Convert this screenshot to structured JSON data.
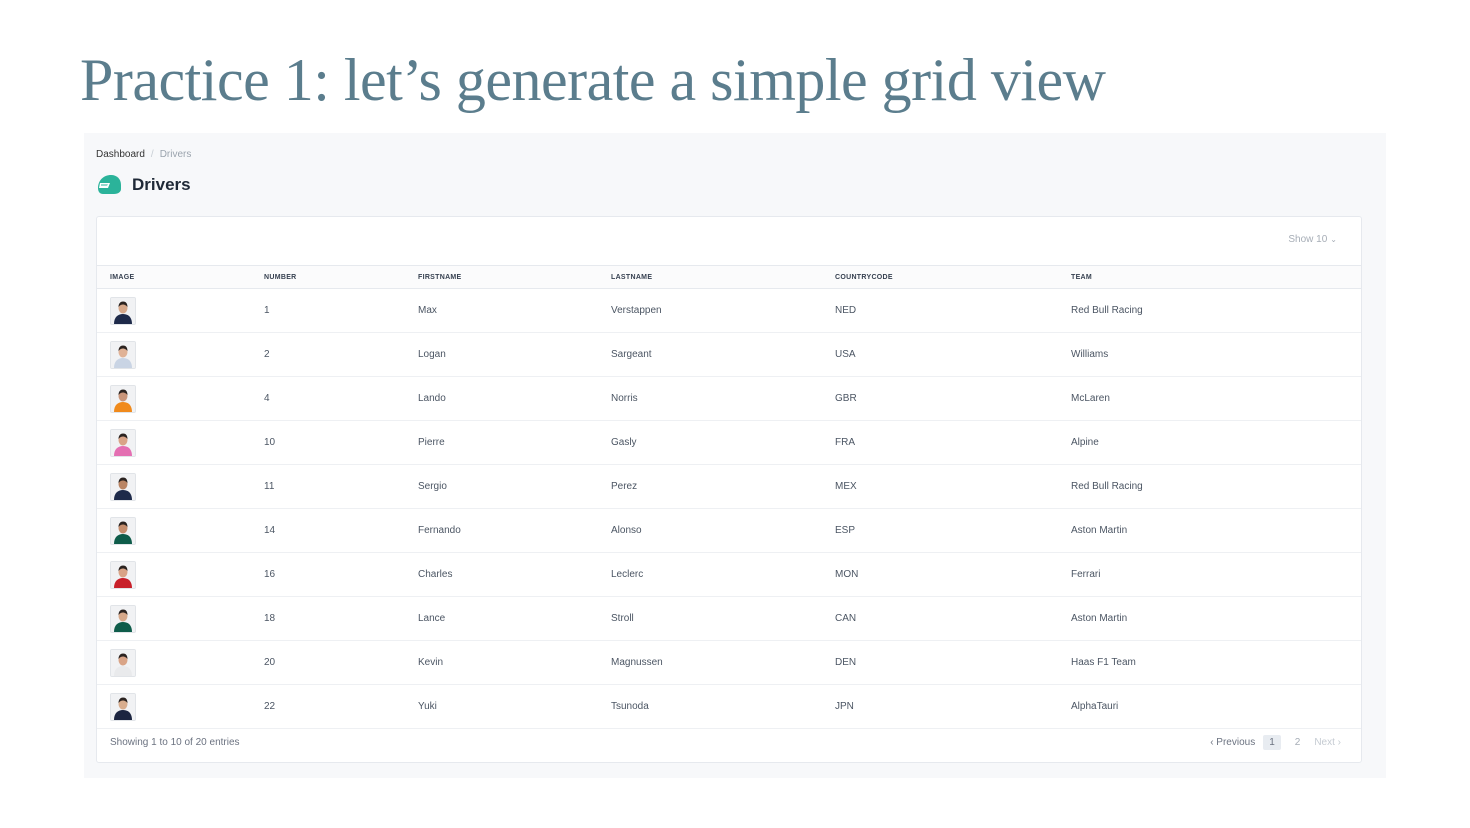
{
  "slide": {
    "title": "Practice 1: let’s generate a simple grid view"
  },
  "breadcrumb": {
    "items": [
      "Dashboard",
      "Drivers"
    ],
    "separator": "/"
  },
  "header": {
    "title": "Drivers",
    "icon": "helmet-icon"
  },
  "toolbar": {
    "show_label": "Show 10",
    "chevron": "⌄"
  },
  "table": {
    "columns": [
      "IMAGE",
      "NUMBER",
      "FIRSTNAME",
      "LASTNAME",
      "COUNTRYCODE",
      "TEAM"
    ],
    "rows": [
      {
        "number": "1",
        "firstname": "Max",
        "lastname": "Verstappen",
        "countrycode": "NED",
        "team": "Red Bull Racing",
        "suit": "#1e2a4a",
        "skin": "#d6a88a"
      },
      {
        "number": "2",
        "firstname": "Logan",
        "lastname": "Sargeant",
        "countrycode": "USA",
        "team": "Williams",
        "suit": "#c9d4e4",
        "skin": "#e0b296"
      },
      {
        "number": "4",
        "firstname": "Lando",
        "lastname": "Norris",
        "countrycode": "GBR",
        "team": "McLaren",
        "suit": "#f08a1c",
        "skin": "#c9957a"
      },
      {
        "number": "10",
        "firstname": "Pierre",
        "lastname": "Gasly",
        "countrycode": "FRA",
        "team": "Alpine",
        "suit": "#e46fb2",
        "skin": "#d9a487"
      },
      {
        "number": "11",
        "firstname": "Sergio",
        "lastname": "Perez",
        "countrycode": "MEX",
        "team": "Red Bull Racing",
        "suit": "#1e2a4a",
        "skin": "#b98463"
      },
      {
        "number": "14",
        "firstname": "Fernando",
        "lastname": "Alonso",
        "countrycode": "ESP",
        "team": "Aston Martin",
        "suit": "#0e5c4a",
        "skin": "#c48d6d"
      },
      {
        "number": "16",
        "firstname": "Charles",
        "lastname": "Leclerc",
        "countrycode": "MON",
        "team": "Ferrari",
        "suit": "#c8202a",
        "skin": "#d9a487"
      },
      {
        "number": "18",
        "firstname": "Lance",
        "lastname": "Stroll",
        "countrycode": "CAN",
        "team": "Aston Martin",
        "suit": "#0e5c4a",
        "skin": "#d6a88a"
      },
      {
        "number": "20",
        "firstname": "Kevin",
        "lastname": "Magnussen",
        "countrycode": "DEN",
        "team": "Haas F1 Team",
        "suit": "#e9eaec",
        "skin": "#d9a487"
      },
      {
        "number": "22",
        "firstname": "Yuki",
        "lastname": "Tsunoda",
        "countrycode": "JPN",
        "team": "AlphaTauri",
        "suit": "#1c2540",
        "skin": "#d8ad8e"
      }
    ]
  },
  "footer": {
    "summary": "Showing 1 to 10 of 20 entries",
    "previous": "Previous",
    "next": "Next",
    "pages": [
      "1",
      "2"
    ],
    "active_page": "1"
  },
  "colors": {
    "accent": "#2bb39a",
    "title": "#5b7d8d"
  }
}
